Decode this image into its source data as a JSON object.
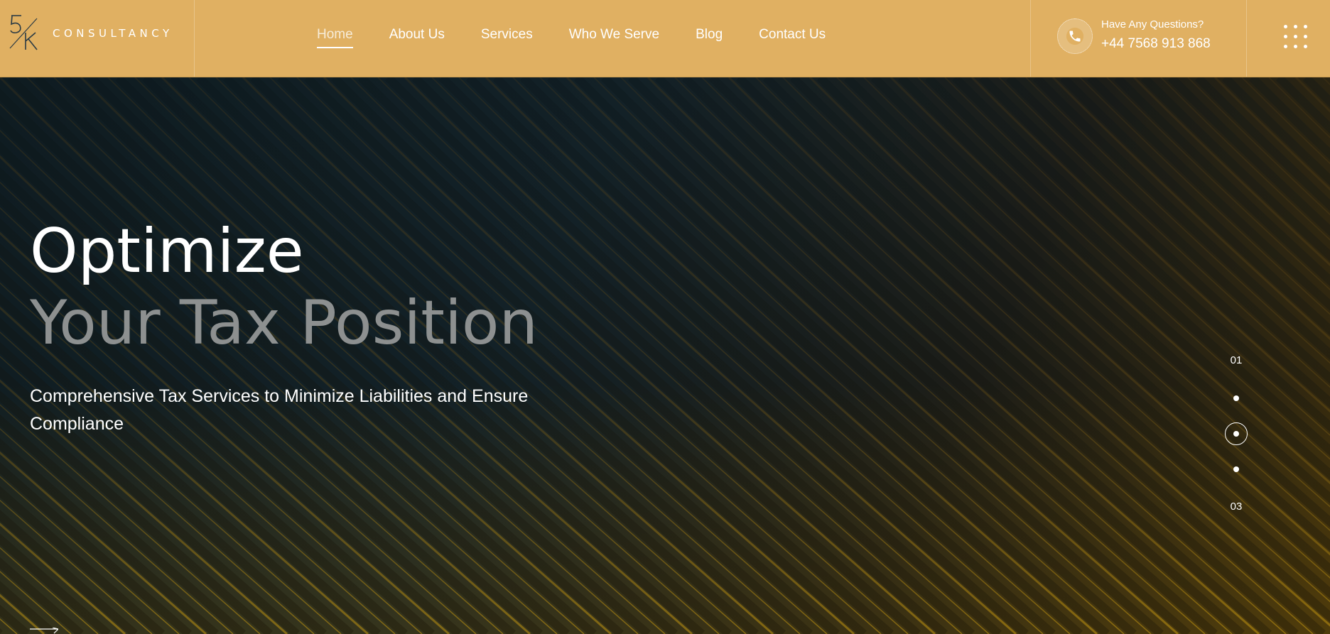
{
  "brand": {
    "logo_text": "CONSULTANCY",
    "logo_mark_icon": "5k-monogram-icon"
  },
  "nav": {
    "items": [
      {
        "label": "Home",
        "active": true
      },
      {
        "label": "About Us"
      },
      {
        "label": "Services"
      },
      {
        "label": "Who We Serve"
      },
      {
        "label": "Blog"
      },
      {
        "label": "Contact Us"
      }
    ]
  },
  "contact": {
    "question": "Have Any Questions?",
    "phone": "+44 7568 913 868",
    "icon": "phone-icon"
  },
  "menu_icon": "grid-menu-icon",
  "hero": {
    "title_line1": "Optimize",
    "title_line2": "Your Tax Position",
    "subtitle": "Comprehensive Tax Services to Minimize Liabilities and Ensure Compliance"
  },
  "slider": {
    "first": "01",
    "last": "03",
    "current_index": 2,
    "dot_count": 3
  },
  "colors": {
    "header_bg": "#e0b062",
    "hero_bg": "#111b1f",
    "accent_gold": "#b8860b",
    "title_muted": "#8d9090"
  }
}
